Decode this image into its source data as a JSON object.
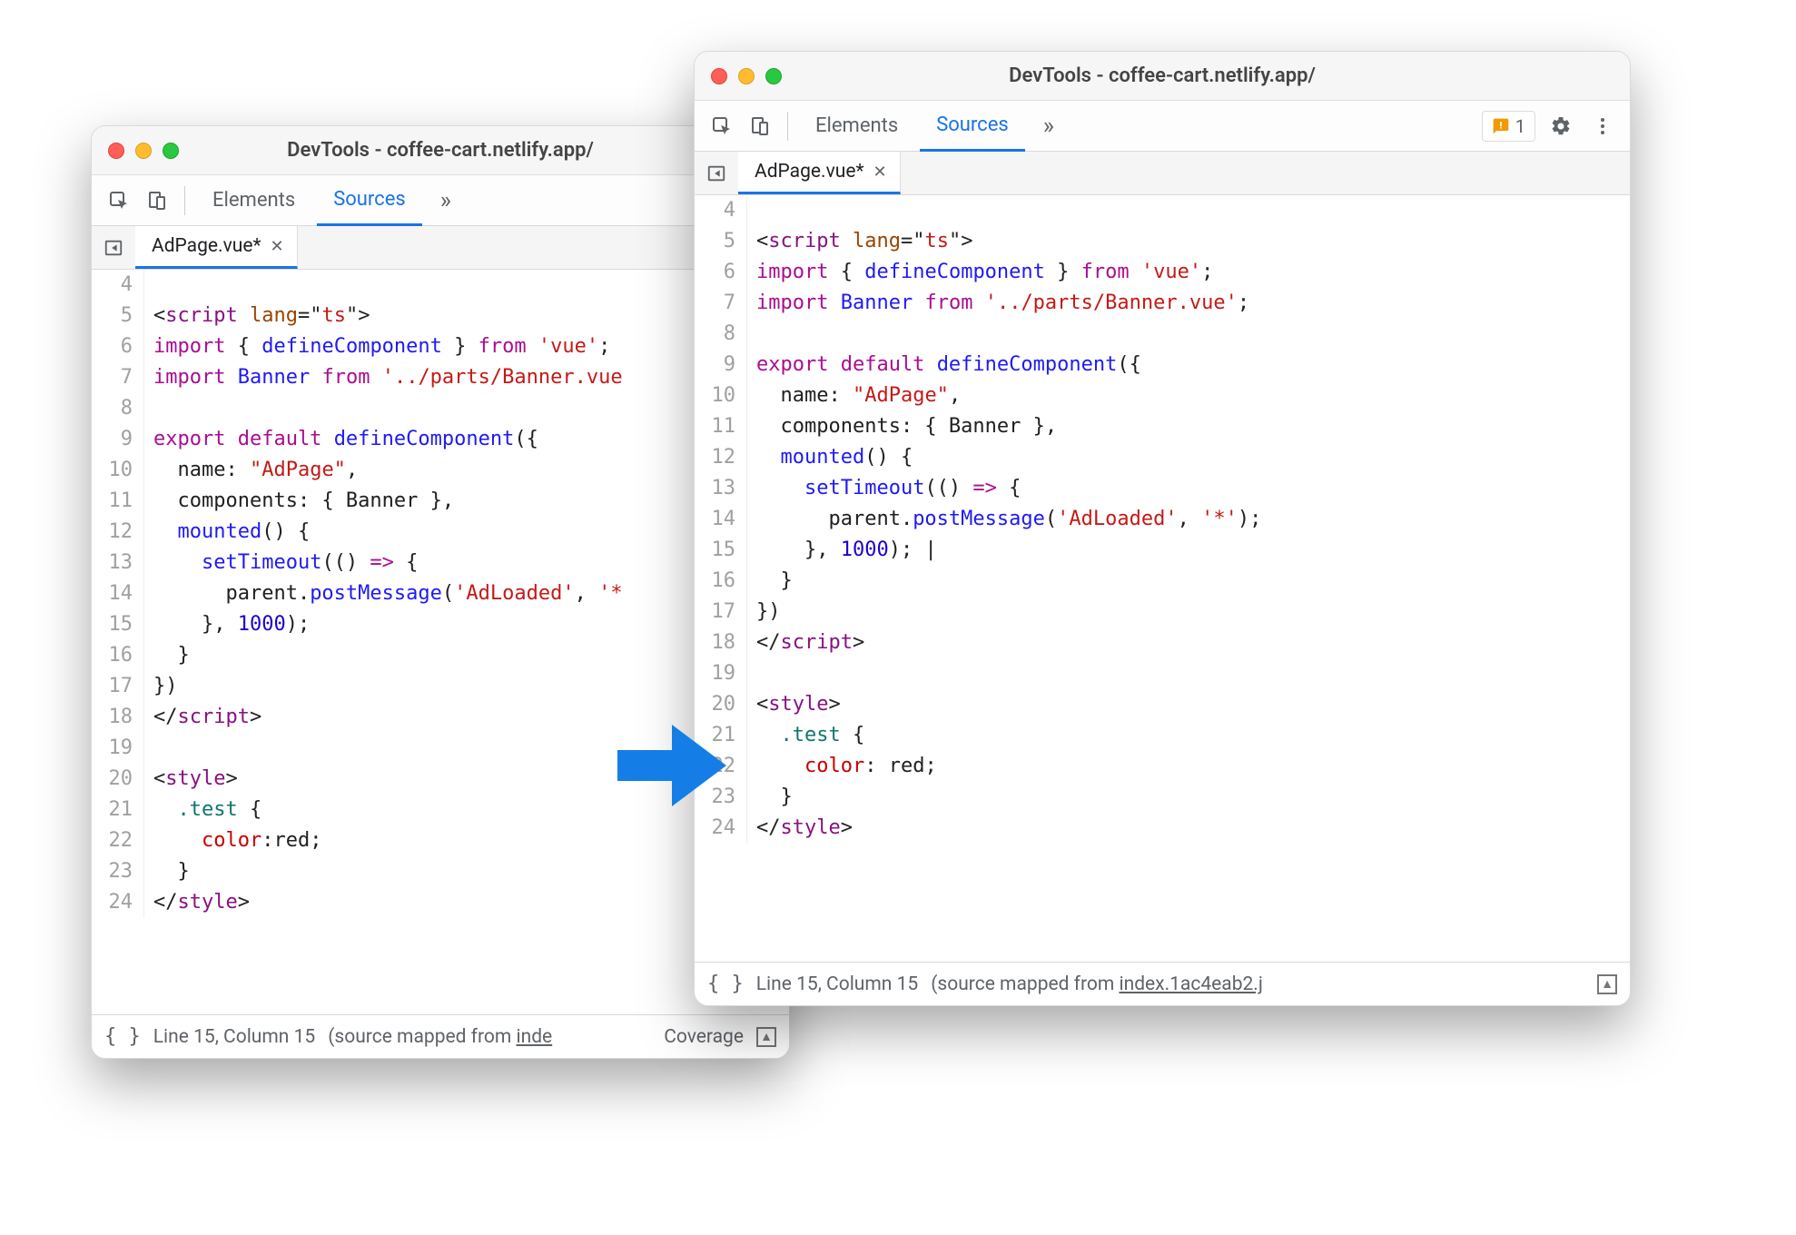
{
  "windowLeft": {
    "title": "DevTools - coffee-cart.netlify.app/",
    "tabs": {
      "elements": "Elements",
      "sources": "Sources"
    },
    "fileTab": "AdPage.vue*",
    "status": {
      "position": "Line 15, Column 15",
      "mappedPrefix": "(source mapped from ",
      "mappedLink": "inde",
      "coverage": "Coverage"
    },
    "code": [
      {
        "n": "4",
        "frags": []
      },
      {
        "n": "5",
        "frags": [
          {
            "c": "c-delim",
            "t": "<"
          },
          {
            "c": "c-tag",
            "t": "script"
          },
          {
            "c": "c-txt",
            "t": " "
          },
          {
            "c": "c-attr",
            "t": "lang"
          },
          {
            "c": "c-delim",
            "t": "="
          },
          {
            "c": "c-quo",
            "t": "\""
          },
          {
            "c": "c-str",
            "t": "ts"
          },
          {
            "c": "c-quo",
            "t": "\""
          },
          {
            "c": "c-delim",
            "t": ">"
          }
        ]
      },
      {
        "n": "6",
        "frags": [
          {
            "c": "c-kw",
            "t": "import"
          },
          {
            "c": "c-txt",
            "t": " { "
          },
          {
            "c": "c-def",
            "t": "defineComponent"
          },
          {
            "c": "c-txt",
            "t": " } "
          },
          {
            "c": "c-kw",
            "t": "from"
          },
          {
            "c": "c-txt",
            "t": " "
          },
          {
            "c": "c-str",
            "t": "'vue'"
          },
          {
            "c": "c-txt",
            "t": ";"
          }
        ]
      },
      {
        "n": "7",
        "frags": [
          {
            "c": "c-kw",
            "t": "import"
          },
          {
            "c": "c-txt",
            "t": " "
          },
          {
            "c": "c-def",
            "t": "Banner"
          },
          {
            "c": "c-txt",
            "t": " "
          },
          {
            "c": "c-kw",
            "t": "from"
          },
          {
            "c": "c-txt",
            "t": " "
          },
          {
            "c": "c-str",
            "t": "'../parts/Banner.vue"
          }
        ]
      },
      {
        "n": "8",
        "frags": []
      },
      {
        "n": "9",
        "frags": [
          {
            "c": "c-kw",
            "t": "export default"
          },
          {
            "c": "c-txt",
            "t": " "
          },
          {
            "c": "c-def",
            "t": "defineComponent"
          },
          {
            "c": "c-txt",
            "t": "({"
          }
        ]
      },
      {
        "n": "10",
        "frags": [
          {
            "c": "c-txt",
            "t": "  name: "
          },
          {
            "c": "c-str",
            "t": "\"AdPage\""
          },
          {
            "c": "c-txt",
            "t": ","
          }
        ]
      },
      {
        "n": "11",
        "frags": [
          {
            "c": "c-txt",
            "t": "  components: { Banner },"
          }
        ]
      },
      {
        "n": "12",
        "frags": [
          {
            "c": "c-txt",
            "t": "  "
          },
          {
            "c": "c-def",
            "t": "mounted"
          },
          {
            "c": "c-txt",
            "t": "() {"
          }
        ]
      },
      {
        "n": "13",
        "frags": [
          {
            "c": "c-txt",
            "t": "    "
          },
          {
            "c": "c-def",
            "t": "setTimeout"
          },
          {
            "c": "c-txt",
            "t": "(() "
          },
          {
            "c": "c-kw",
            "t": "=>"
          },
          {
            "c": "c-txt",
            "t": " {"
          }
        ]
      },
      {
        "n": "14",
        "frags": [
          {
            "c": "c-txt",
            "t": "      parent."
          },
          {
            "c": "c-def",
            "t": "postMessage"
          },
          {
            "c": "c-txt",
            "t": "("
          },
          {
            "c": "c-str",
            "t": "'AdLoaded'"
          },
          {
            "c": "c-txt",
            "t": ", "
          },
          {
            "c": "c-str",
            "t": "'*"
          }
        ]
      },
      {
        "n": "15",
        "frags": [
          {
            "c": "c-txt",
            "t": "    }, "
          },
          {
            "c": "c-num",
            "t": "1000"
          },
          {
            "c": "c-txt",
            "t": ");"
          }
        ]
      },
      {
        "n": "16",
        "frags": [
          {
            "c": "c-txt",
            "t": "  }"
          }
        ]
      },
      {
        "n": "17",
        "frags": [
          {
            "c": "c-txt",
            "t": "})"
          }
        ]
      },
      {
        "n": "18",
        "frags": [
          {
            "c": "c-delim",
            "t": "</"
          },
          {
            "c": "c-tag",
            "t": "script"
          },
          {
            "c": "c-delim",
            "t": ">"
          }
        ]
      },
      {
        "n": "19",
        "frags": []
      },
      {
        "n": "20",
        "frags": [
          {
            "c": "c-delim",
            "t": "<"
          },
          {
            "c": "c-tag",
            "t": "style"
          },
          {
            "c": "c-delim",
            "t": ">"
          }
        ]
      },
      {
        "n": "21",
        "frags": [
          {
            "c": "c-txt",
            "t": "  "
          },
          {
            "c": "c-css",
            "t": ".test"
          },
          {
            "c": "c-txt",
            "t": " {"
          }
        ]
      },
      {
        "n": "22",
        "frags": [
          {
            "c": "c-txt",
            "t": "    "
          },
          {
            "c": "c-cssprop",
            "t": "color"
          },
          {
            "c": "c-txt",
            "t": ":red;"
          }
        ]
      },
      {
        "n": "23",
        "frags": [
          {
            "c": "c-txt",
            "t": "  }"
          }
        ]
      },
      {
        "n": "24",
        "frags": [
          {
            "c": "c-delim",
            "t": "</"
          },
          {
            "c": "c-tag",
            "t": "style"
          },
          {
            "c": "c-delim",
            "t": ">"
          }
        ]
      }
    ]
  },
  "windowRight": {
    "title": "DevTools - coffee-cart.netlify.app/",
    "tabs": {
      "elements": "Elements",
      "sources": "Sources"
    },
    "fileTab": "AdPage.vue*",
    "issuesCount": "1",
    "status": {
      "position": "Line 15, Column 15",
      "mappedPrefix": "(source mapped from ",
      "mappedLink": "index.1ac4eab2.j"
    },
    "code": [
      {
        "n": "4",
        "frags": []
      },
      {
        "n": "5",
        "frags": [
          {
            "c": "c-delim",
            "t": "<"
          },
          {
            "c": "c-tag",
            "t": "script"
          },
          {
            "c": "c-txt",
            "t": " "
          },
          {
            "c": "c-attr",
            "t": "lang"
          },
          {
            "c": "c-delim",
            "t": "="
          },
          {
            "c": "c-quo",
            "t": "\""
          },
          {
            "c": "c-str",
            "t": "ts"
          },
          {
            "c": "c-quo",
            "t": "\""
          },
          {
            "c": "c-delim",
            "t": ">"
          }
        ]
      },
      {
        "n": "6",
        "frags": [
          {
            "c": "c-kw",
            "t": "import"
          },
          {
            "c": "c-txt",
            "t": " { "
          },
          {
            "c": "c-def",
            "t": "defineComponent"
          },
          {
            "c": "c-txt",
            "t": " } "
          },
          {
            "c": "c-kw",
            "t": "from"
          },
          {
            "c": "c-txt",
            "t": " "
          },
          {
            "c": "c-str",
            "t": "'vue'"
          },
          {
            "c": "c-txt",
            "t": ";"
          }
        ]
      },
      {
        "n": "7",
        "frags": [
          {
            "c": "c-kw",
            "t": "import"
          },
          {
            "c": "c-txt",
            "t": " "
          },
          {
            "c": "c-def",
            "t": "Banner"
          },
          {
            "c": "c-txt",
            "t": " "
          },
          {
            "c": "c-kw",
            "t": "from"
          },
          {
            "c": "c-txt",
            "t": " "
          },
          {
            "c": "c-str",
            "t": "'../parts/Banner.vue'"
          },
          {
            "c": "c-txt",
            "t": ";"
          }
        ]
      },
      {
        "n": "8",
        "frags": []
      },
      {
        "n": "9",
        "frags": [
          {
            "c": "c-kw",
            "t": "export default"
          },
          {
            "c": "c-txt",
            "t": " "
          },
          {
            "c": "c-def",
            "t": "defineComponent"
          },
          {
            "c": "c-txt",
            "t": "({"
          }
        ]
      },
      {
        "n": "10",
        "frags": [
          {
            "c": "c-txt",
            "t": "  name: "
          },
          {
            "c": "c-str",
            "t": "\"AdPage\""
          },
          {
            "c": "c-txt",
            "t": ","
          }
        ]
      },
      {
        "n": "11",
        "frags": [
          {
            "c": "c-txt",
            "t": "  components: { Banner },"
          }
        ]
      },
      {
        "n": "12",
        "frags": [
          {
            "c": "c-txt",
            "t": "  "
          },
          {
            "c": "c-def",
            "t": "mounted"
          },
          {
            "c": "c-txt",
            "t": "() {"
          }
        ]
      },
      {
        "n": "13",
        "frags": [
          {
            "c": "c-txt",
            "t": "    "
          },
          {
            "c": "c-def",
            "t": "setTimeout"
          },
          {
            "c": "c-txt",
            "t": "(() "
          },
          {
            "c": "c-kw",
            "t": "=>"
          },
          {
            "c": "c-txt",
            "t": " {"
          }
        ]
      },
      {
        "n": "14",
        "frags": [
          {
            "c": "c-txt",
            "t": "      parent."
          },
          {
            "c": "c-def",
            "t": "postMessage"
          },
          {
            "c": "c-txt",
            "t": "("
          },
          {
            "c": "c-str",
            "t": "'AdLoaded'"
          },
          {
            "c": "c-txt",
            "t": ", "
          },
          {
            "c": "c-str",
            "t": "'*'"
          },
          {
            "c": "c-txt",
            "t": ");"
          }
        ]
      },
      {
        "n": "15",
        "frags": [
          {
            "c": "c-txt",
            "t": "    }, "
          },
          {
            "c": "c-num",
            "t": "1000"
          },
          {
            "c": "c-txt",
            "t": "); |"
          }
        ]
      },
      {
        "n": "16",
        "frags": [
          {
            "c": "c-txt",
            "t": "  }"
          }
        ]
      },
      {
        "n": "17",
        "frags": [
          {
            "c": "c-txt",
            "t": "})"
          }
        ]
      },
      {
        "n": "18",
        "frags": [
          {
            "c": "c-delim",
            "t": "</"
          },
          {
            "c": "c-tag",
            "t": "script"
          },
          {
            "c": "c-delim",
            "t": ">"
          }
        ]
      },
      {
        "n": "19",
        "frags": []
      },
      {
        "n": "20",
        "frags": [
          {
            "c": "c-delim",
            "t": "<"
          },
          {
            "c": "c-tag",
            "t": "style"
          },
          {
            "c": "c-delim",
            "t": ">"
          }
        ]
      },
      {
        "n": "21",
        "frags": [
          {
            "c": "c-txt",
            "t": "  "
          },
          {
            "c": "c-css",
            "t": ".test"
          },
          {
            "c": "c-txt",
            "t": " {"
          }
        ]
      },
      {
        "n": "22",
        "frags": [
          {
            "c": "c-txt",
            "t": "    "
          },
          {
            "c": "c-cssprop",
            "t": "color"
          },
          {
            "c": "c-txt",
            "t": ": red;"
          }
        ]
      },
      {
        "n": "23",
        "frags": [
          {
            "c": "c-txt",
            "t": "  }"
          }
        ]
      },
      {
        "n": "24",
        "frags": [
          {
            "c": "c-delim",
            "t": "</"
          },
          {
            "c": "c-tag",
            "t": "style"
          },
          {
            "c": "c-delim",
            "t": ">"
          }
        ]
      }
    ]
  }
}
